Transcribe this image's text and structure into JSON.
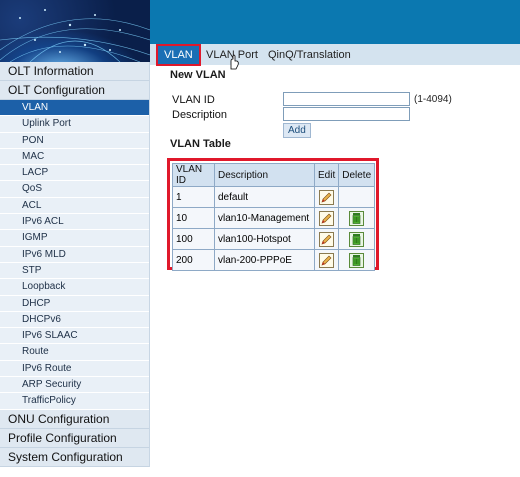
{
  "tabs": [
    {
      "label": "VLAN",
      "active": true
    },
    {
      "label": "VLAN Port",
      "active": false
    },
    {
      "label": "QinQ/Translation",
      "active": false
    }
  ],
  "sidebar": {
    "groups": [
      {
        "label": "OLT Information"
      },
      {
        "label": "OLT Configuration"
      },
      {
        "label": "ONU Configuration"
      },
      {
        "label": "Profile Configuration"
      },
      {
        "label": "System Configuration"
      }
    ],
    "items": [
      {
        "label": "VLAN",
        "active": true
      },
      {
        "label": "Uplink Port"
      },
      {
        "label": "PON"
      },
      {
        "label": "MAC"
      },
      {
        "label": "LACP"
      },
      {
        "label": "QoS"
      },
      {
        "label": "ACL"
      },
      {
        "label": "IPv6 ACL"
      },
      {
        "label": "IGMP"
      },
      {
        "label": "IPv6 MLD"
      },
      {
        "label": "STP"
      },
      {
        "label": "Loopback"
      },
      {
        "label": "DHCP"
      },
      {
        "label": "DHCPv6"
      },
      {
        "label": "IPv6 SLAAC"
      },
      {
        "label": "Route"
      },
      {
        "label": "IPv6 Route"
      },
      {
        "label": "ARP Security"
      },
      {
        "label": "TrafficPolicy"
      }
    ]
  },
  "new_vlan": {
    "title": "New VLAN",
    "vlan_id_label": "VLAN ID",
    "vlan_id_value": "",
    "vlan_id_hint": "(1-4094)",
    "description_label": "Description",
    "description_value": "",
    "add_label": "Add"
  },
  "vlan_table": {
    "title": "VLAN Table",
    "headers": [
      "VLAN ID",
      "Description",
      "Edit",
      "Delete"
    ],
    "rows": [
      {
        "id": "1",
        "description": "default",
        "editable": true,
        "deletable": false
      },
      {
        "id": "10",
        "description": "vlan10-Management",
        "editable": true,
        "deletable": true
      },
      {
        "id": "100",
        "description": "vlan100-Hotspot",
        "editable": true,
        "deletable": true
      },
      {
        "id": "200",
        "description": "vlan-200-PPPoE",
        "editable": true,
        "deletable": true
      }
    ]
  },
  "colors": {
    "banner": "#0b78b0",
    "active_nav": "#1c60a8",
    "highlight_border": "#e0182b"
  },
  "icons": {
    "edit": "edit-pencil-icon",
    "delete": "delete-trash-icon"
  }
}
